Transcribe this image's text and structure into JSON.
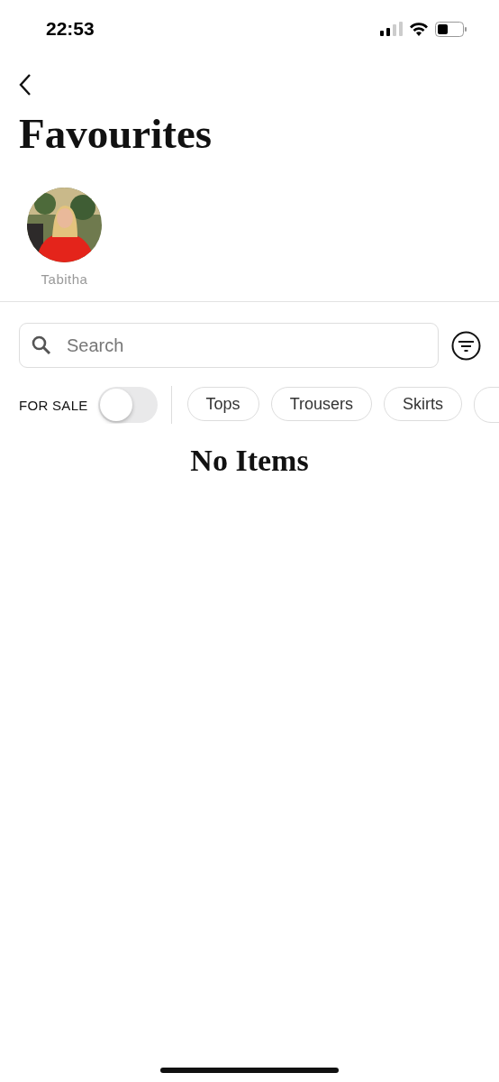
{
  "status_bar": {
    "time": "22:53"
  },
  "title": "Favourites",
  "people": [
    {
      "name": "Tabitha"
    }
  ],
  "search": {
    "placeholder": "Search"
  },
  "for_sale": {
    "label": "FOR SALE",
    "on": false
  },
  "categories": [
    {
      "label": "Tops",
      "selected": false
    },
    {
      "label": "Trousers",
      "selected": false
    },
    {
      "label": "Skirts",
      "selected": false
    }
  ],
  "empty_message": "No Items"
}
